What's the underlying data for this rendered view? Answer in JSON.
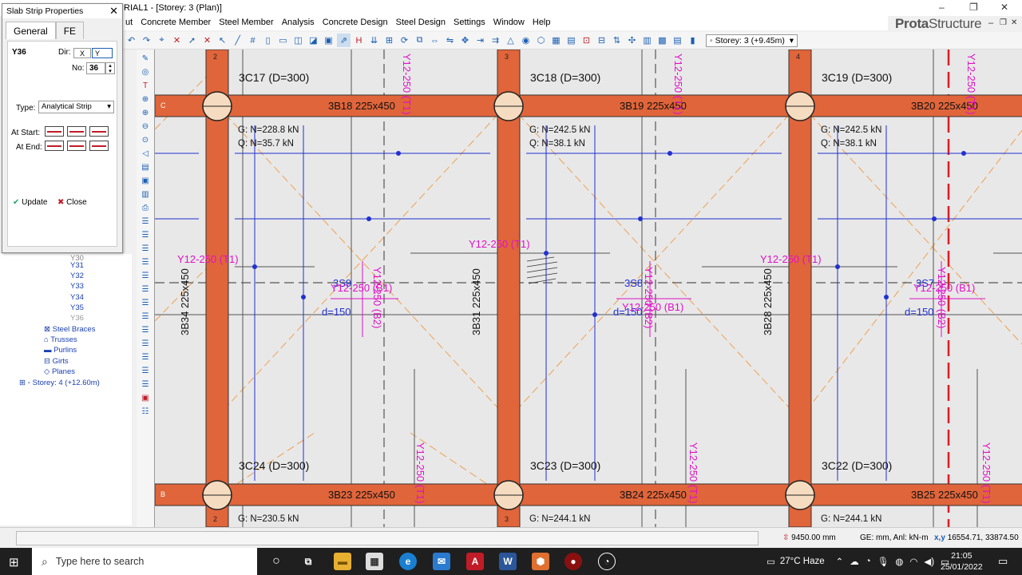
{
  "window": {
    "title": "RIAL1 - [Storey: 3 (Plan)]",
    "brand_bold": "Prota",
    "brand_rest": "Structure",
    "min": "–",
    "restore": "❐",
    "close": "✕",
    "inner_min": "–",
    "inner_restore": "❐",
    "inner_close": "✕"
  },
  "menu": [
    "ut",
    "Concrete Member",
    "Steel Member",
    "Analysis",
    "Concrete Design",
    "Steel Design",
    "Settings",
    "Window",
    "Help"
  ],
  "toolbar": {
    "storey_label": "Storey: 3 (+9.45m)"
  },
  "dialog": {
    "title": "Slab Strip Properties",
    "close": "✕",
    "tab_general": "General",
    "tab_fe": "FE",
    "strip_id": "Y36",
    "dir_label": "Dir:",
    "dir_x": "X",
    "dir_y": "Y",
    "no_label": "No:",
    "no_value": "36",
    "type_label": "Type:",
    "type_value": "Analytical Strip",
    "at_start": "At Start:",
    "at_end": "At End:",
    "update": "Update",
    "close_btn": "Close"
  },
  "tree": {
    "items": [
      "Y30",
      "Y31",
      "Y32",
      "Y33",
      "Y34",
      "Y35",
      "Y36"
    ],
    "steel_braces": "Steel Braces",
    "trusses": "Trusses",
    "purlins": "Purlins",
    "girts": "Girts",
    "planes": "Planes",
    "storey4": "Storey: 4 (+12.60m)"
  },
  "plan": {
    "beams_top": [
      "3B18 225x450",
      "3B19 225x450",
      "3B20 225x450"
    ],
    "beams_bottom": [
      "3B23 225x450",
      "3B24 225x450",
      "3B25 225x450"
    ],
    "cols_top": [
      "3C17 (D=300)",
      "3C18 (D=300)",
      "3C19 (D=300)"
    ],
    "cols_bottom": [
      "3C24 (D=300)",
      "3C23 (D=300)",
      "3C22 (D=300)"
    ],
    "vbeams": [
      "3B34 225x450",
      "3B31 225x450",
      "3B28 225x450"
    ],
    "loads_top": [
      {
        "g": "G: N=228.8 kN",
        "q": "Q: N=35.7 kN"
      },
      {
        "g": "G: N=242.5 kN",
        "q": "Q: N=38.1 kN"
      },
      {
        "g": "G: N=242.5 kN",
        "q": "Q: N=38.1 kN"
      }
    ],
    "loads_bottom": [
      "G: N=230.5 kN",
      "G: N=244.1 kN",
      "G: N=244.1 kN"
    ],
    "slabs": [
      "3S9",
      "3S8",
      "3S7"
    ],
    "slab_d": [
      "d=150",
      "d=150",
      "d=150"
    ],
    "rebar_t1": "Y12-250 (T1)",
    "rebar_b1": "Y12-250 (B1)",
    "rebar_b2": "Y12-250 (B2)",
    "rebar_t1_v": "Y12-250 (T1)",
    "grid_top": [
      "2",
      "3",
      "4"
    ],
    "grid_bottom": [
      "2",
      "3"
    ],
    "grid_c": "C",
    "grid_b": "B"
  },
  "status": {
    "length": "9450.00 mm",
    "units": "GE: mm,  Anl: kN-m",
    "coords": "16554.71, 33874.50"
  },
  "taskbar": {
    "search": "Type here to search",
    "weather": "27°C  Haze",
    "time": "21:05",
    "date": "25/01/2022"
  },
  "colors": {
    "beam": "#e0653a",
    "rebar": "#e010c8",
    "dim": "#2030d0",
    "accent": "#1a5fb4"
  }
}
